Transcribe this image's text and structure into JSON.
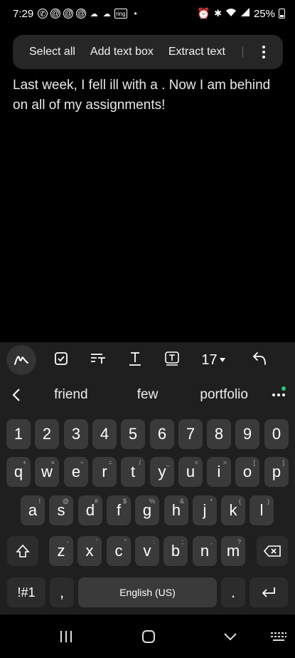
{
  "status_bar": {
    "time": "7:29",
    "left_icons": [
      "whatsapp-icon",
      "at-icon",
      "at-icon",
      "at-icon",
      "cloud-icon",
      "cloud-icon",
      "ring-icon"
    ],
    "ring_label": "ring",
    "dot": "•",
    "battery": "25%"
  },
  "context_menu": {
    "select_all": "Select all",
    "add_text_box": "Add text box",
    "extract_text": "Extract text"
  },
  "note": {
    "text": "Last week, I fell ill with a . Now I am behind on all of my assignments!"
  },
  "toolbar": {
    "font_size": "17"
  },
  "suggestions": [
    "friend",
    "few",
    "portfolio"
  ],
  "keyboard": {
    "numbers": [
      "1",
      "2",
      "3",
      "4",
      "5",
      "6",
      "7",
      "8",
      "9",
      "0"
    ],
    "row1": [
      {
        "k": "q",
        "s": "+"
      },
      {
        "k": "w",
        "s": "×"
      },
      {
        "k": "e",
        "s": "÷"
      },
      {
        "k": "r",
        "s": "="
      },
      {
        "k": "t",
        "s": "/"
      },
      {
        "k": "y",
        "s": "_"
      },
      {
        "k": "u",
        "s": "<"
      },
      {
        "k": "i",
        "s": ">"
      },
      {
        "k": "o",
        "s": "["
      },
      {
        "k": "p",
        "s": "]"
      }
    ],
    "row2": [
      {
        "k": "a",
        "s": "!"
      },
      {
        "k": "s",
        "s": "@"
      },
      {
        "k": "d",
        "s": "#"
      },
      {
        "k": "f",
        "s": "$"
      },
      {
        "k": "g",
        "s": "%"
      },
      {
        "k": "h",
        "s": "&"
      },
      {
        "k": "j",
        "s": "*"
      },
      {
        "k": "k",
        "s": "("
      },
      {
        "k": "l",
        "s": ")"
      }
    ],
    "row3": [
      {
        "k": "z",
        "s": "-"
      },
      {
        "k": "x",
        "s": "'"
      },
      {
        "k": "c",
        "s": "\""
      },
      {
        "k": "v",
        "s": ":"
      },
      {
        "k": "b",
        "s": ";"
      },
      {
        "k": "n",
        "s": ","
      },
      {
        "k": "m",
        "s": "?"
      }
    ],
    "symbols_label": "!#1",
    "comma": ",",
    "space_label": "English (US)",
    "period": "."
  },
  "nav": {
    "recents": "recents-icon",
    "home": "home-icon",
    "back": "back-icon",
    "keyboard": "keyboard-icon"
  }
}
